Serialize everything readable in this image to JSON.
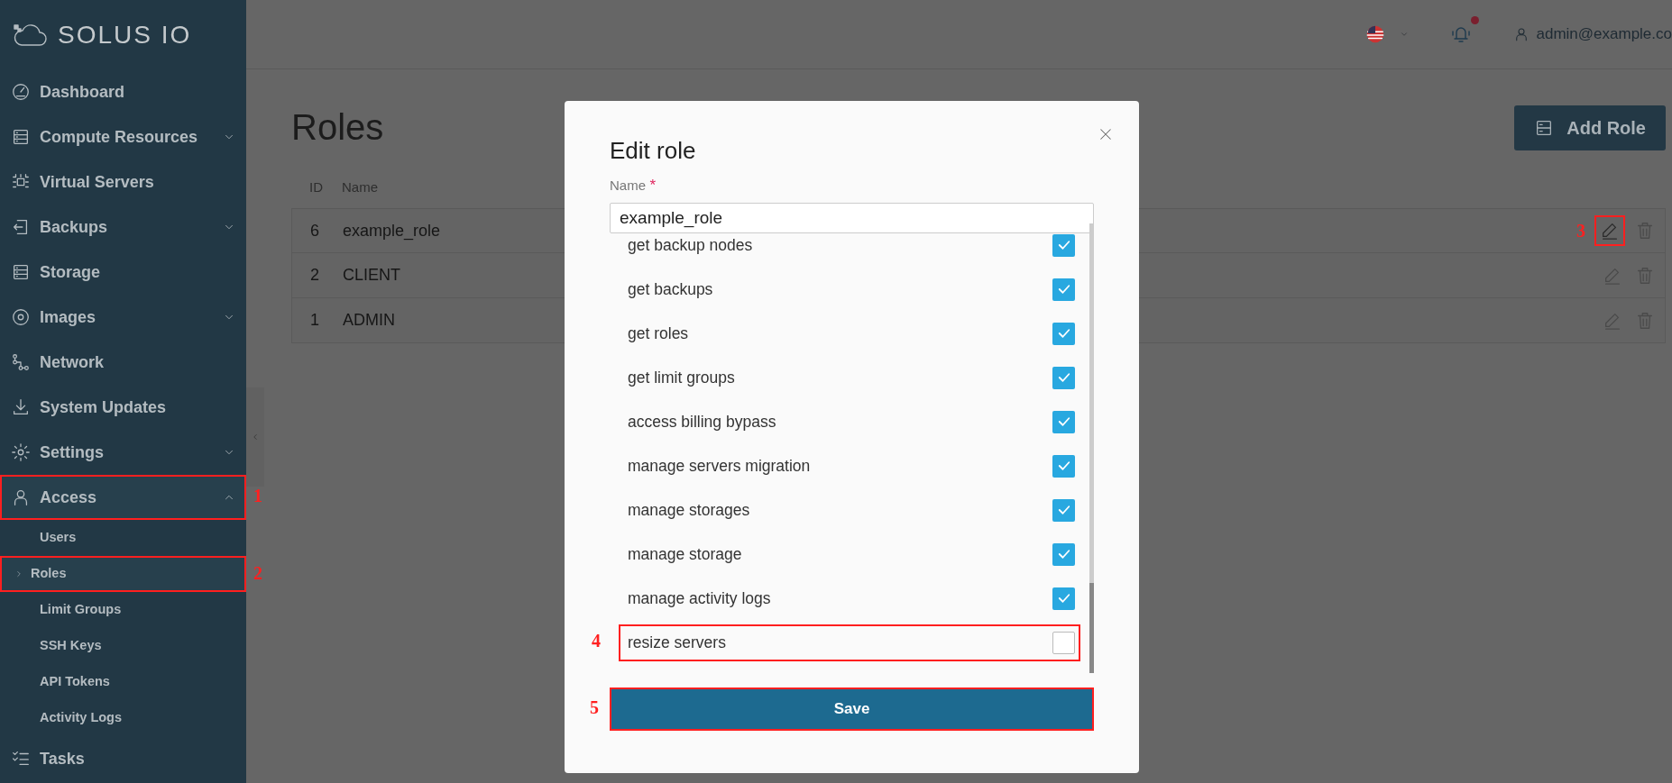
{
  "sidebar": {
    "logo_text": "SOLUS IO",
    "items": [
      {
        "label": "Dashboard"
      },
      {
        "label": "Compute Resources",
        "expanded": false
      },
      {
        "label": "Virtual Servers"
      },
      {
        "label": "Backups",
        "expanded": false
      },
      {
        "label": "Storage"
      },
      {
        "label": "Images",
        "expanded": false
      },
      {
        "label": "Network"
      },
      {
        "label": "System Updates"
      },
      {
        "label": "Settings",
        "expanded": false
      },
      {
        "label": "Access",
        "expanded": true,
        "callout": "1",
        "children": [
          {
            "label": "Users",
            "selected": false
          },
          {
            "label": "Roles",
            "selected": true,
            "callout": "2"
          },
          {
            "label": "Limit Groups",
            "selected": false
          },
          {
            "label": "SSH Keys",
            "selected": false
          },
          {
            "label": "API Tokens",
            "selected": false
          },
          {
            "label": "Activity Logs",
            "selected": false
          }
        ]
      },
      {
        "label": "Tasks"
      }
    ]
  },
  "header": {
    "user": "admin@example.co",
    "notification_dot": true
  },
  "page": {
    "title": "Roles",
    "add_button": "Add Role",
    "table": {
      "columns": [
        "ID",
        "Name"
      ],
      "rows": [
        {
          "id": "6",
          "name": "example_role",
          "edit_callout": "3"
        },
        {
          "id": "2",
          "name": "CLIENT"
        },
        {
          "id": "1",
          "name": "ADMIN"
        }
      ]
    }
  },
  "modal": {
    "title": "Edit role",
    "name_label": "Name",
    "required_mark": "*",
    "name_value": "example_role",
    "permissions": [
      {
        "label": "get backup nodes",
        "checked": true
      },
      {
        "label": "get backups",
        "checked": true
      },
      {
        "label": "get roles",
        "checked": true
      },
      {
        "label": "get limit groups",
        "checked": true
      },
      {
        "label": "access billing bypass",
        "checked": true
      },
      {
        "label": "manage servers migration",
        "checked": true
      },
      {
        "label": "manage storages",
        "checked": true
      },
      {
        "label": "manage storage",
        "checked": true
      },
      {
        "label": "manage activity logs",
        "checked": true
      },
      {
        "label": "resize servers",
        "checked": false,
        "callout": "4"
      }
    ],
    "save_button": "Save",
    "save_callout": "5"
  }
}
